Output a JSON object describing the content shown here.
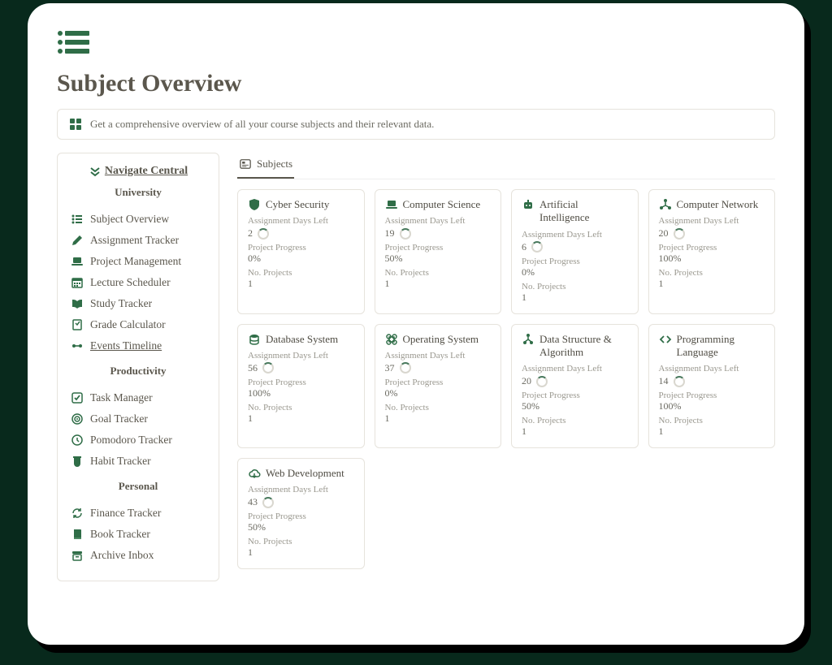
{
  "page": {
    "title": "Subject Overview",
    "callout": "Get a comprehensive overview of all your course subjects and their relevant data."
  },
  "sidebar": {
    "nav_title": "Navigate Central",
    "sections": {
      "university": {
        "label": "University",
        "items": [
          {
            "icon": "list",
            "label": "Subject Overview"
          },
          {
            "icon": "pencil",
            "label": "Assignment Tracker"
          },
          {
            "icon": "laptop",
            "label": "Project Management"
          },
          {
            "icon": "calendar-grid",
            "label": "Lecture Scheduler"
          },
          {
            "icon": "book-open",
            "label": "Study Tracker"
          },
          {
            "icon": "grade",
            "label": "Grade Calculator"
          },
          {
            "icon": "timeline",
            "label": "Events Timeline"
          }
        ]
      },
      "productivity": {
        "label": "Productivity",
        "items": [
          {
            "icon": "check-square",
            "label": "Task Manager"
          },
          {
            "icon": "target",
            "label": "Goal Tracker"
          },
          {
            "icon": "clock",
            "label": "Pomodoro Tracker"
          },
          {
            "icon": "cup",
            "label": "Habit Tracker"
          }
        ]
      },
      "personal": {
        "label": "Personal",
        "items": [
          {
            "icon": "refresh-dollar",
            "label": "Finance Tracker"
          },
          {
            "icon": "book",
            "label": "Book Tracker"
          },
          {
            "icon": "archive",
            "label": "Archive Inbox"
          }
        ]
      }
    }
  },
  "tab": {
    "label": "Subjects"
  },
  "field_labels": {
    "days_left": "Assignment Days Left",
    "progress": "Project Progress",
    "projects": "No. Projects"
  },
  "subjects": [
    {
      "icon": "shield",
      "title": "Cyber Security",
      "days_left": "2",
      "progress": "0%",
      "projects": "1"
    },
    {
      "icon": "laptop",
      "title": "Computer Science",
      "days_left": "19",
      "progress": "50%",
      "projects": "1"
    },
    {
      "icon": "robot",
      "title": "Artificial Intelligence",
      "days_left": "6",
      "progress": "0%",
      "projects": "1"
    },
    {
      "icon": "network",
      "title": "Computer Network",
      "days_left": "20",
      "progress": "100%",
      "projects": "1"
    },
    {
      "icon": "database",
      "title": "Database System",
      "days_left": "56",
      "progress": "100%",
      "projects": "1"
    },
    {
      "icon": "command",
      "title": "Operating System",
      "days_left": "37",
      "progress": "0%",
      "projects": "1"
    },
    {
      "icon": "tree",
      "title": "Data Structure & Algorithm",
      "days_left": "20",
      "progress": "50%",
      "projects": "1"
    },
    {
      "icon": "code",
      "title": "Programming Language",
      "days_left": "14",
      "progress": "100%",
      "projects": "1"
    },
    {
      "icon": "cloud",
      "title": "Web Development",
      "days_left": "43",
      "progress": "50%",
      "projects": "1"
    }
  ]
}
